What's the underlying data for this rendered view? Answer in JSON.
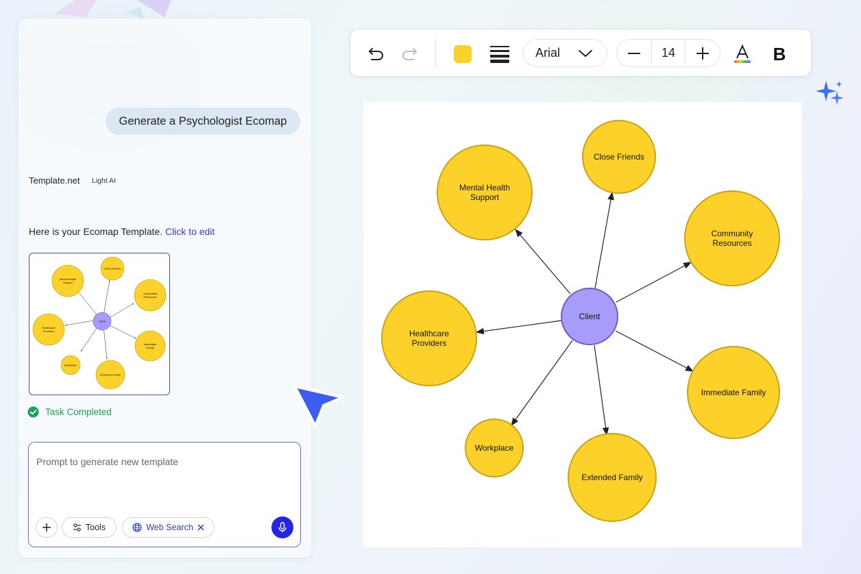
{
  "chat": {
    "user_message": "Generate a Psychologist Ecomap",
    "brand": "Template.net",
    "brand_tag": "Light AI",
    "reply_text": "Here is your Ecomap Template.",
    "reply_link": "Click to edit",
    "task_status": "Task Completed"
  },
  "prompt": {
    "placeholder": "Prompt to generate new template",
    "tools_label": "Tools",
    "web_search_label": "Web Search"
  },
  "toolbar": {
    "font": "Arial",
    "font_size": "14",
    "fill_color": "#FCD12A",
    "bold_label": "B"
  },
  "ecomap": {
    "center": "Client",
    "center_color": "#A89CFA",
    "node_color": "#FCD12A",
    "nodes": [
      {
        "id": "mental",
        "label": "Mental Health\nSupport"
      },
      {
        "id": "friends",
        "label": "Close Friends"
      },
      {
        "id": "community",
        "label": "Community\nResources"
      },
      {
        "id": "health",
        "label": "Healthcare\nProviders"
      },
      {
        "id": "immediate",
        "label": "Immediate Family"
      },
      {
        "id": "workplace",
        "label": "Workplace"
      },
      {
        "id": "extended",
        "label": "Extended Family"
      }
    ]
  },
  "thumbnail": {
    "center": "Client",
    "nodes": [
      {
        "id": "mental",
        "label": "Mental Health\nSupport"
      },
      {
        "id": "friends",
        "label": "Close Friends"
      },
      {
        "id": "community",
        "label": "Community\nResources"
      },
      {
        "id": "health",
        "label": "Healthcare\nProviders"
      },
      {
        "id": "immediate",
        "label": "Immediate Family"
      },
      {
        "id": "workplace",
        "label": "Workplace"
      },
      {
        "id": "extended",
        "label": "Extended Family"
      }
    ]
  }
}
